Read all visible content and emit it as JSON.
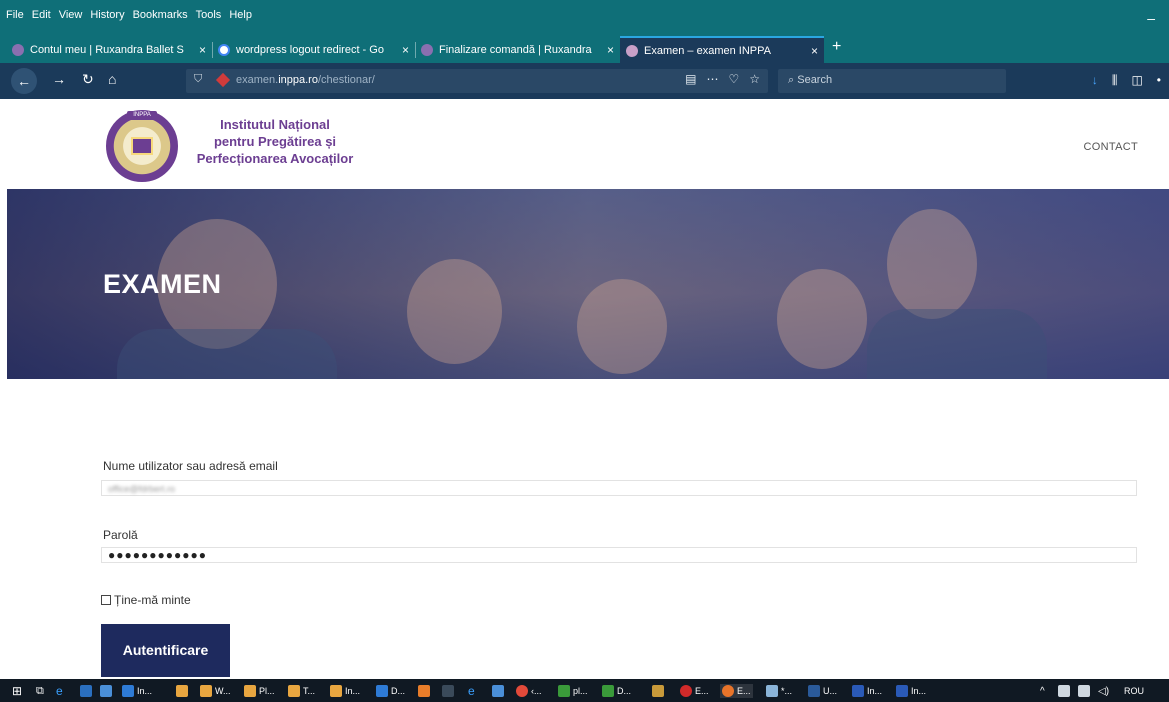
{
  "browser": {
    "menu": [
      "File",
      "Edit",
      "View",
      "History",
      "Bookmarks",
      "Tools",
      "Help"
    ],
    "minimize_symbol": "–",
    "tabs": [
      {
        "title": "Contul meu | Ruxandra Ballet S",
        "favicon_color": "#8a6fb0",
        "active": false
      },
      {
        "title": "wordpress logout redirect - Go",
        "favicon_color": "#ffffff",
        "active": false
      },
      {
        "title": "Finalizare comandă | Ruxandra",
        "favicon_color": "#8a6fb0",
        "active": false
      },
      {
        "title": "Examen – examen INPPA",
        "favicon_color": "#c9a0c8",
        "active": true
      }
    ],
    "tab_close_symbol": "×",
    "new_tab_symbol": "+",
    "url": {
      "prefix": "examen.",
      "domain": "inppa.ro",
      "path": "/chestionar/"
    },
    "search_placeholder": "Search",
    "accent_color": "#0f6f78"
  },
  "site": {
    "brand_line1": "Institutul Național",
    "brand_line2": "pentru Pregătirea și",
    "brand_line3": "Perfecționarea Avocaților",
    "logo_text": "INPPA",
    "nav_contact": "CONTACT",
    "brand_color": "#6c3e92"
  },
  "hero": {
    "title": "EXAMEN"
  },
  "login": {
    "username_label": "Nume utilizator sau adresă email",
    "username_value": "office@fdrbert.ro",
    "password_label": "Parolă",
    "password_value": "●●●●●●●●●●●●",
    "remember_label": "Ține-mă minte",
    "submit_label": "Autentificare",
    "button_color": "#1e2a5e"
  },
  "taskbar": {
    "items": [
      "In...",
      "W...",
      "Pl...",
      "T...",
      "In...",
      "D...",
      "‹...",
      "pl...",
      "D...",
      "E...",
      "E...",
      "*...",
      "U...",
      "In...",
      "In..."
    ],
    "language": "ROU"
  }
}
